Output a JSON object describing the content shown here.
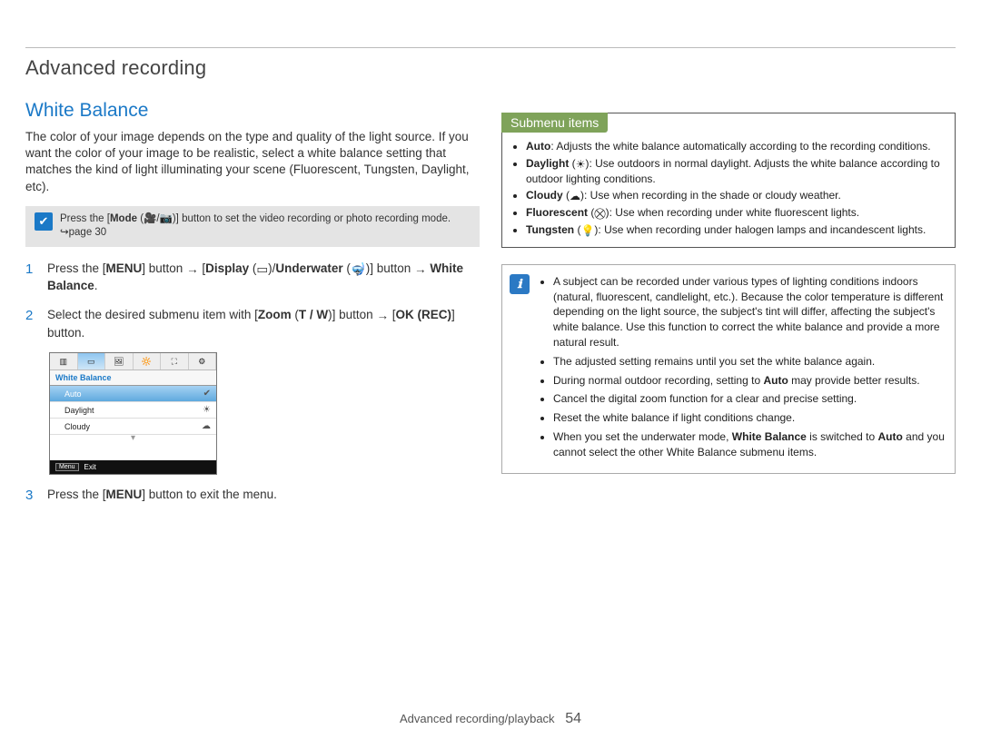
{
  "chapter_title": "Advanced recording",
  "section_title": "White Balance",
  "intro_text": "The color of your image depends on the type and quality of the light source. If you want the color of your image to be realistic, select a white balance setting that matches the kind of light illuminating your scene (Fluorescent, Tungsten, Daylight, etc).",
  "mode_note": {
    "prefix": "Press the [",
    "bold_mode": "Mode",
    "mid": " (🎥/📷)] button to set the video recording or photo recording mode. ",
    "pageref": "↪page 30"
  },
  "steps": {
    "s1": {
      "num": "1",
      "menu_label": "MENU",
      "disp_label": "Display",
      "disp_icon": "display-frame-icon",
      "under_label": "Underwater",
      "under_icon": "underwater-icon",
      "wb_label": "White Balance",
      "tail_button_word": "button"
    },
    "s2": {
      "num": "2",
      "text_a": "Select the desired submenu item with [",
      "zoom_label": "Zoom",
      "tw_label": "T / W",
      "text_b": "] button",
      "okrec_label": "OK (REC)",
      "text_c": "] button."
    },
    "s3": {
      "num": "3",
      "text": "Press the [MENU] button to exit the menu."
    }
  },
  "device_mock": {
    "header": "White Balance",
    "rows": [
      {
        "label": "Auto",
        "icon": "✔",
        "selected": true
      },
      {
        "label": "Daylight",
        "icon": "☀",
        "selected": false
      },
      {
        "label": "Cloudy",
        "icon": "☁",
        "selected": false
      }
    ],
    "exit_btn": "Menu",
    "exit_label": "Exit"
  },
  "submenu_header": "Submenu items",
  "submenu_items": {
    "auto": {
      "name": "Auto",
      "text": ": Adjusts the white balance automatically according to the recording conditions."
    },
    "daylight": {
      "name": "Daylight",
      "glyph": "☀",
      "text": "): Use outdoors in normal daylight. Adjusts the white balance according to outdoor lighting conditions."
    },
    "cloudy": {
      "name": "Cloudy",
      "glyph": "☁",
      "text": "): Use when recording in the shade or cloudy weather."
    },
    "fluor": {
      "name": "Fluorescent",
      "glyph": "⛒",
      "text": "): Use when recording under white fluorescent lights."
    },
    "tungsten": {
      "name": "Tungsten",
      "glyph": "💡",
      "text": "): Use when recording under halogen lamps and incandescent lights."
    }
  },
  "tips": {
    "t1": "A subject can be recorded under various types of lighting conditions indoors (natural, fluorescent, candlelight, etc.). Because the color temperature is different depending on the light source, the subject's tint will differ, affecting the subject's white balance. Use this function to correct the white balance and provide a more natural result.",
    "t2": "The adjusted setting remains until you set the white balance again.",
    "t3_a": "During normal outdoor recording, setting to ",
    "t3_bold": "Auto",
    "t3_b": " may provide better results.",
    "t4": "Cancel the digital zoom function for a clear and precise setting.",
    "t5": "Reset the white balance if light conditions change.",
    "t6_a": "When you set the underwater mode, ",
    "t6_bold1": "White Balance",
    "t6_b": " is switched to ",
    "t6_bold2": "Auto",
    "t6_c": " and you cannot select the other White Balance submenu items."
  },
  "footer": {
    "trail": "Advanced recording/playback",
    "page_number": "54"
  }
}
